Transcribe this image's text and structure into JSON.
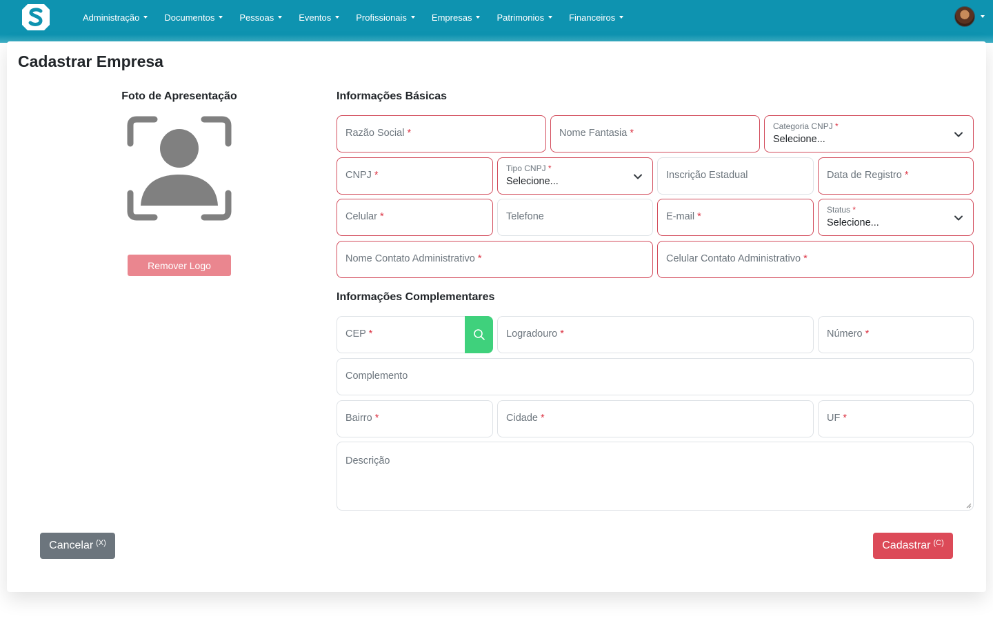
{
  "nav": {
    "items": [
      "Administração",
      "Documentos",
      "Pessoas",
      "Eventos",
      "Profissionais",
      "Empresas",
      "Patrimonios",
      "Financeiros"
    ]
  },
  "page": {
    "title": "Cadastrar Empresa"
  },
  "photo": {
    "title": "Foto de Apresentação",
    "remove_label": "Remover Logo"
  },
  "basic": {
    "title": "Informações Básicas",
    "razao_social": "Razão Social",
    "nome_fantasia": "Nome Fantasia",
    "categoria_cnpj": {
      "label": "Categoria CNPJ",
      "value": "Selecione..."
    },
    "cnpj": "CNPJ",
    "tipo_cnpj": {
      "label": "Tipo CNPJ",
      "value": "Selecione..."
    },
    "inscricao_estadual": "Inscrição Estadual",
    "data_registro": "Data de Registro",
    "celular": "Celular",
    "telefone": "Telefone",
    "email": "E-mail",
    "status": {
      "label": "Status",
      "value": "Selecione..."
    },
    "nome_contato_admin": "Nome Contato Administrativo",
    "celular_contato_admin": "Celular Contato Administrativo"
  },
  "complement": {
    "title": "Informações Complementares",
    "cep": "CEP",
    "logradouro": "Logradouro",
    "numero": "Número",
    "complemento": "Complemento",
    "bairro": "Bairro",
    "cidade": "Cidade",
    "uf": "UF",
    "descricao": "Descrição"
  },
  "actions": {
    "cancel_label": "Cancelar",
    "cancel_hotkey": "(X)",
    "save_label": "Cadastrar",
    "save_hotkey": "(C)"
  },
  "required_mark": "*",
  "colors": {
    "navbar": "#0e93b0",
    "required": "#dc3545",
    "search_button": "#3fd17c",
    "cancel": "#6c757d",
    "save": "#dc4a58"
  },
  "icons": [
    "app-logo-icon",
    "caret-down-icon",
    "user-avatar",
    "user-placeholder-icon",
    "chevron-down-icon",
    "search-icon"
  ]
}
